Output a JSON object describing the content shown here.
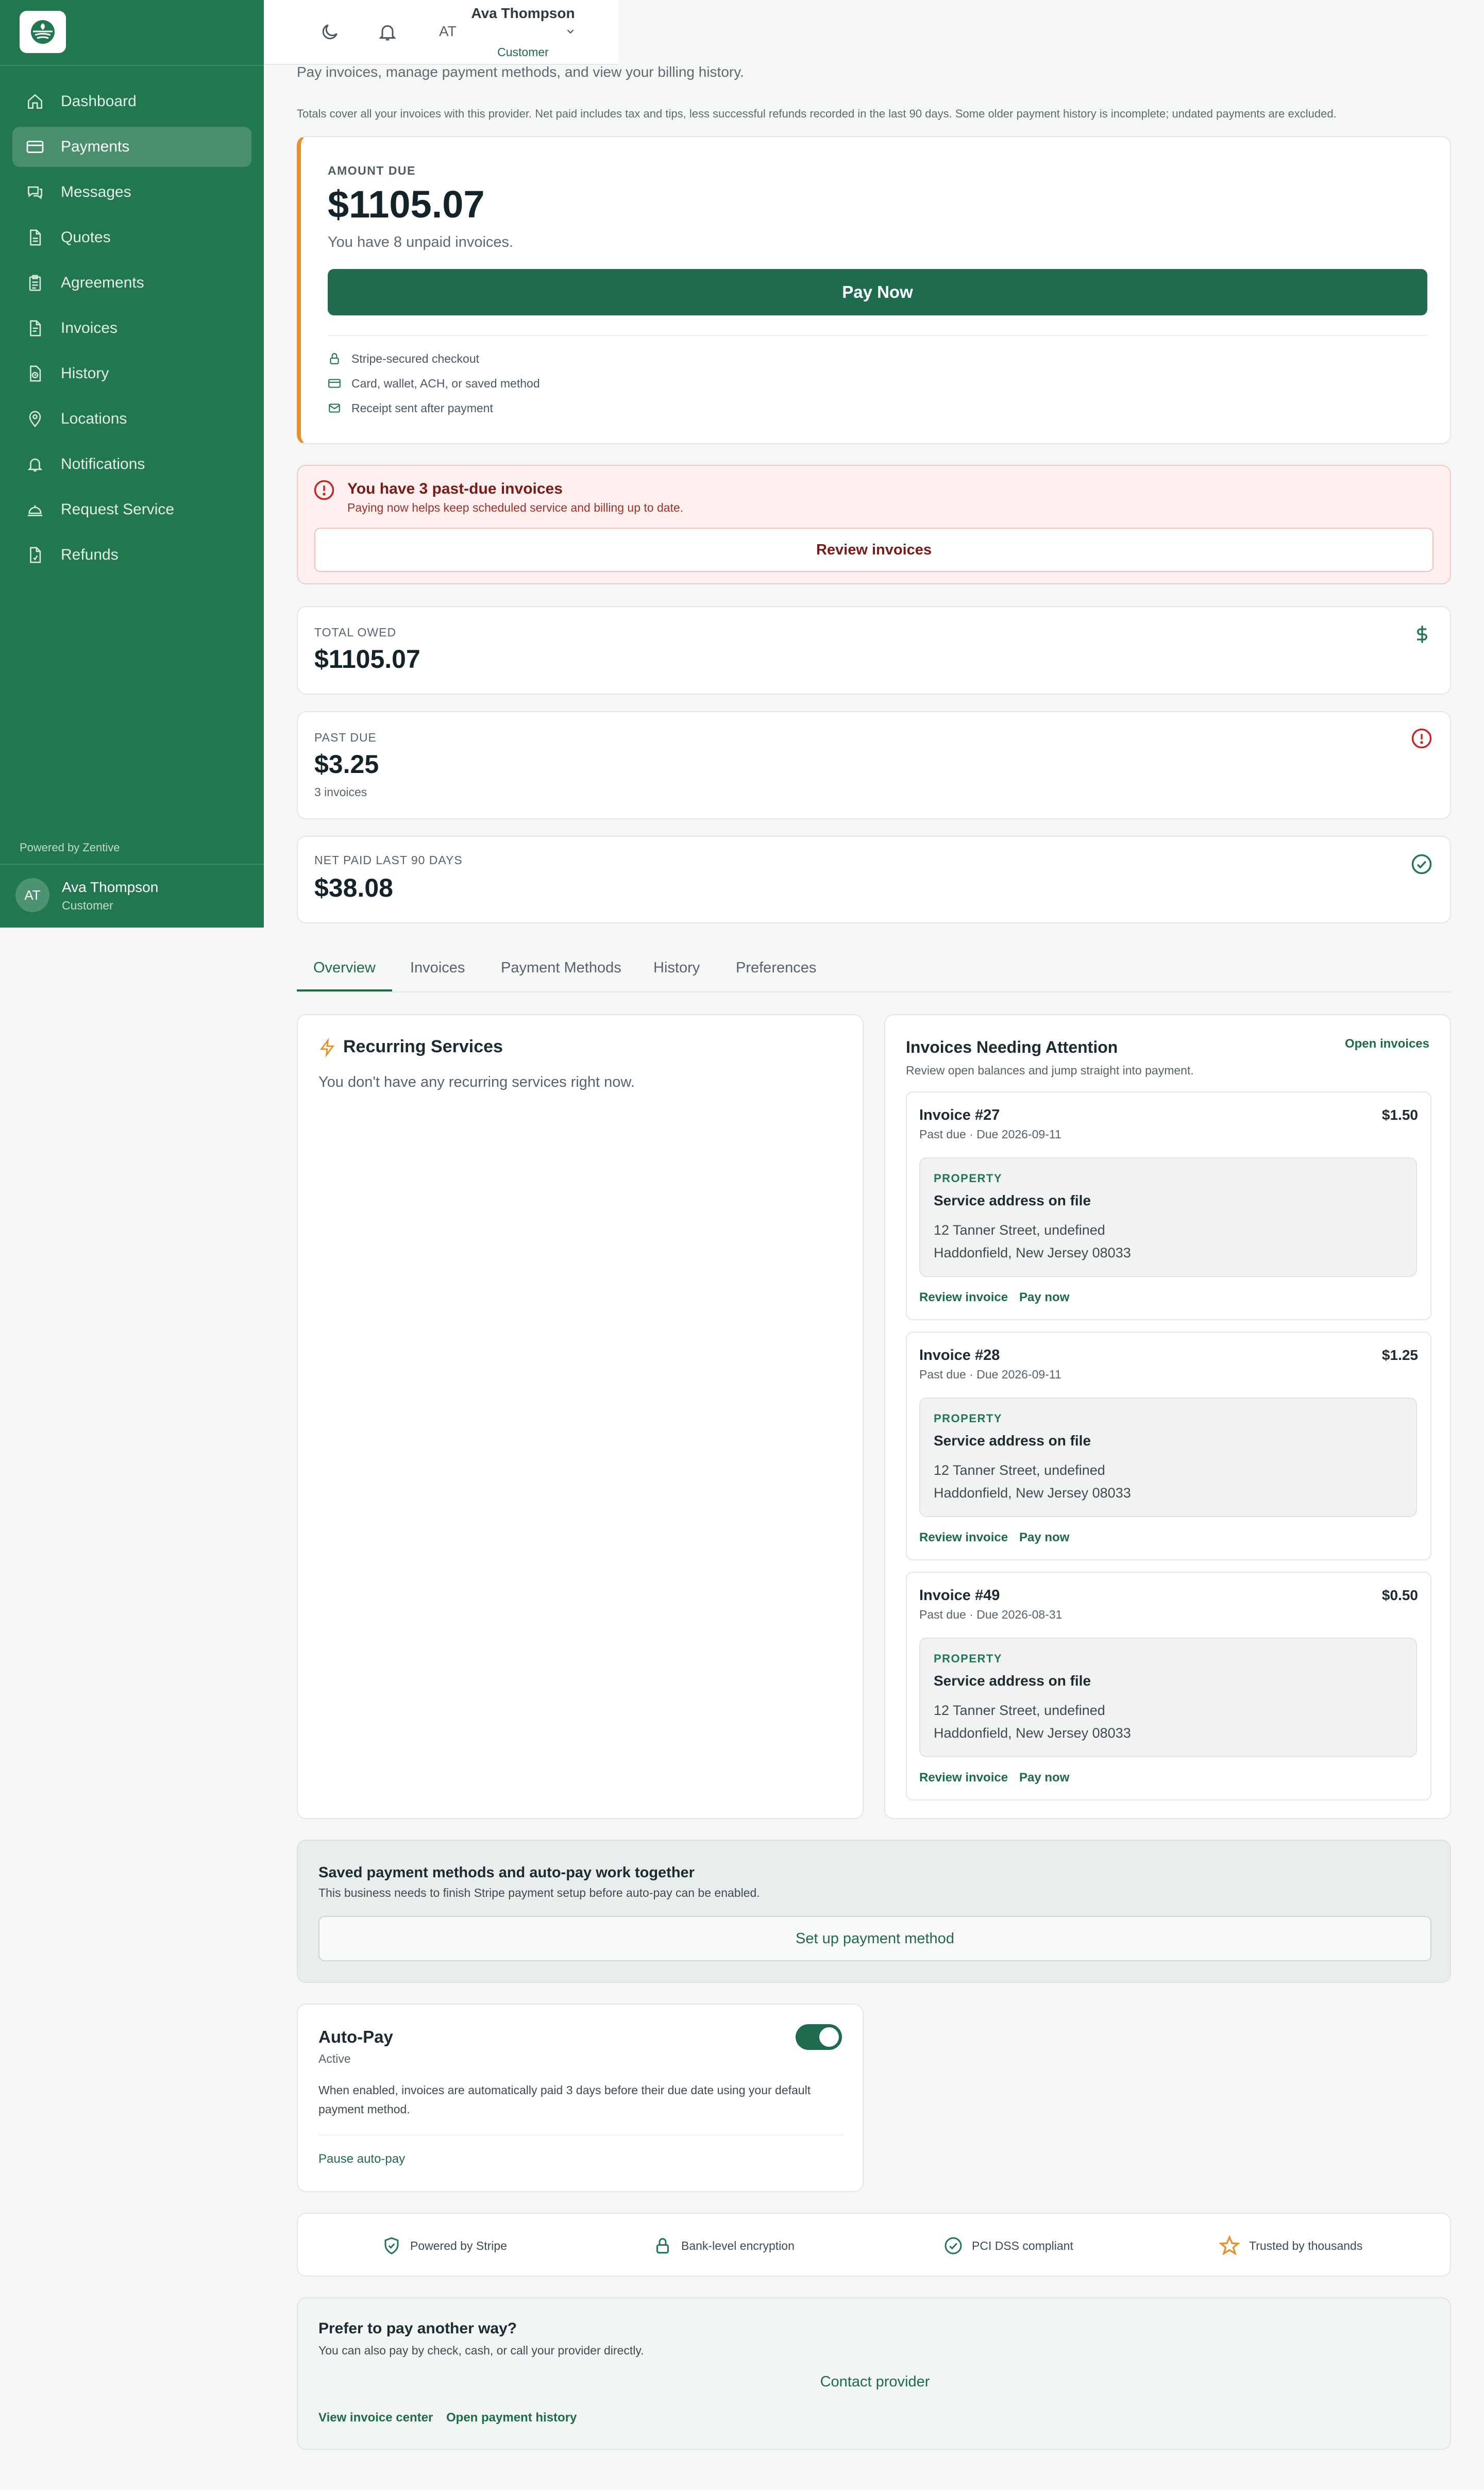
{
  "sidebar": {
    "items": [
      {
        "label": "Dashboard",
        "icon": "home-icon"
      },
      {
        "label": "Payments",
        "icon": "credit-card-icon",
        "active": true
      },
      {
        "label": "Messages",
        "icon": "chat-icon"
      },
      {
        "label": "Quotes",
        "icon": "document-icon"
      },
      {
        "label": "Agreements",
        "icon": "clipboard-icon"
      },
      {
        "label": "Invoices",
        "icon": "invoice-icon"
      },
      {
        "label": "History",
        "icon": "history-icon"
      },
      {
        "label": "Locations",
        "icon": "map-pin-icon"
      },
      {
        "label": "Notifications",
        "icon": "bell-icon"
      },
      {
        "label": "Request Service",
        "icon": "service-bell-icon"
      },
      {
        "label": "Refunds",
        "icon": "refund-icon"
      }
    ],
    "powered_by": "Powered by Zentive",
    "user": {
      "initials": "AT",
      "name": "Ava Thompson",
      "role": "Customer"
    }
  },
  "topbar": {
    "initials": "AT",
    "name": "Ava Thompson",
    "role": "Customer"
  },
  "page": {
    "subtitle": "Pay invoices, manage payment methods, and view your billing history.",
    "note": "Totals cover all your invoices with this provider. Net paid includes tax and tips, less successful refunds recorded in the last 90 days. Some older payment history is incomplete; undated payments are excluded."
  },
  "amount_due": {
    "label": "AMOUNT DUE",
    "value": "$1105.07",
    "sub": "You have 8 unpaid invoices.",
    "button": "Pay Now",
    "features": [
      "Stripe-secured checkout",
      "Card, wallet, ACH, or saved method",
      "Receipt sent after payment"
    ]
  },
  "alert": {
    "title": "You have 3 past-due invoices",
    "sub": "Paying now helps keep scheduled service and billing up to date.",
    "button": "Review invoices"
  },
  "stats": [
    {
      "label": "TOTAL OWED",
      "value": "$1105.07",
      "sub": ""
    },
    {
      "label": "PAST DUE",
      "value": "$3.25",
      "sub": "3 invoices"
    },
    {
      "label": "NET PAID LAST 90 DAYS",
      "value": "$38.08",
      "sub": ""
    }
  ],
  "tabs": [
    "Overview",
    "Invoices",
    "Payment Methods",
    "History",
    "Preferences"
  ],
  "recurring": {
    "title": "Recurring Services",
    "empty": "You don't have any recurring services right now."
  },
  "attention": {
    "title": "Invoices Needing Attention",
    "link": "Open invoices",
    "sub": "Review open balances and jump straight into payment.",
    "invoices": [
      {
        "title": "Invoice #27",
        "amount": "$1.50",
        "due": "Past due · Due 2026-09-11",
        "prop_label": "PROPERTY",
        "prop_title": "Service address on file",
        "line1": "12 Tanner Street, undefined",
        "line2": "Haddonfield, New Jersey 08033",
        "review": "Review invoice",
        "pay": "Pay now"
      },
      {
        "title": "Invoice #28",
        "amount": "$1.25",
        "due": "Past due · Due 2026-09-11",
        "prop_label": "PROPERTY",
        "prop_title": "Service address on file",
        "line1": "12 Tanner Street, undefined",
        "line2": "Haddonfield, New Jersey 08033",
        "review": "Review invoice",
        "pay": "Pay now"
      },
      {
        "title": "Invoice #49",
        "amount": "$0.50",
        "due": "Past due · Due 2026-08-31",
        "prop_label": "PROPERTY",
        "prop_title": "Service address on file",
        "line1": "12 Tanner Street, undefined",
        "line2": "Haddonfield, New Jersey 08033",
        "review": "Review invoice",
        "pay": "Pay now"
      }
    ]
  },
  "saved_methods": {
    "title": "Saved payment methods and auto-pay work together",
    "sub": "This business needs to finish Stripe payment setup before auto-pay can be enabled.",
    "button": "Set up payment method"
  },
  "autopay": {
    "title": "Auto-Pay",
    "status": "Active",
    "desc": "When enabled, invoices are automatically paid 3 days before their due date using your default payment method.",
    "pause": "Pause auto-pay"
  },
  "trust": [
    "Powered by Stripe",
    "Bank-level encryption",
    "PCI DSS compliant",
    "Trusted by thousands"
  ],
  "other": {
    "title": "Prefer to pay another way?",
    "sub": "You can also pay by check, cash, or call your provider directly.",
    "contact": "Contact provider",
    "link1": "View invoice center",
    "link2": "Open payment history"
  },
  "colors": {
    "brand": "#21774f",
    "accent": "#e8902e",
    "danger": "#c62828"
  }
}
